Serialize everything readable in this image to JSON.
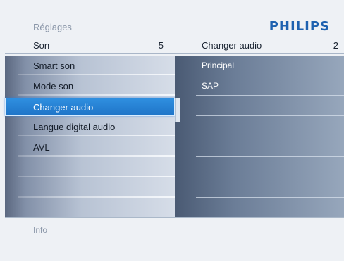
{
  "header": {
    "title": "Réglages",
    "brand": "PHILIPS"
  },
  "left_column": {
    "title": "Son",
    "count": "5"
  },
  "right_column": {
    "title": "Changer audio",
    "count": "2"
  },
  "menu_items": [
    {
      "label": "Smart son"
    },
    {
      "label": "Mode son"
    },
    {
      "label": "Changer audio",
      "selected": true
    },
    {
      "label": "Langue digital audio"
    },
    {
      "label": "AVL"
    }
  ],
  "options": [
    {
      "label": "Principal"
    },
    {
      "label": "SAP"
    }
  ],
  "footer": {
    "info": "Info"
  },
  "colors": {
    "brand": "#1d61b0",
    "selection": "#2b86d8"
  }
}
